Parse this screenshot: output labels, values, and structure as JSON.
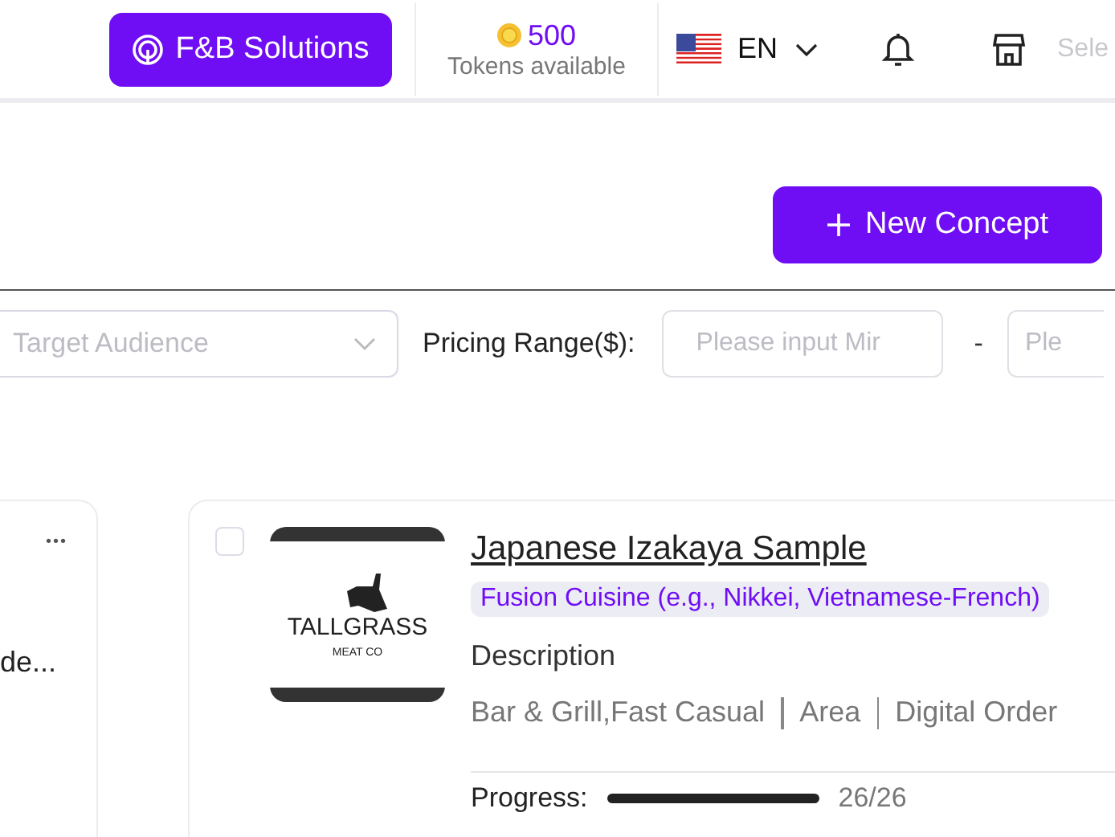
{
  "header": {
    "brand_button": "F&B Solutions",
    "tokens": {
      "amount": "500",
      "label": "Tokens available"
    },
    "language": "EN",
    "store_label": "Sele"
  },
  "new_concept_button": "New Concept",
  "filters": {
    "audience_placeholder": "Target Audience",
    "pricing_label": "Pricing Range($):",
    "min_placeholder": "Please input Mir",
    "separator": "-",
    "max_placeholder": "Ple"
  },
  "cards": [
    {
      "kind": "partial",
      "more": "•••",
      "text": "de..."
    },
    {
      "kind": "concept",
      "checked": false,
      "logo": {
        "name": "TALLGRASS",
        "sub": "MEAT CO"
      },
      "title": "Japanese Izakaya Sample",
      "tags": [
        "Fusion Cuisine (e.g., Nikkei, Vietnamese-French)"
      ],
      "description_label": "Description",
      "meta": [
        "Bar & Grill,Fast Casual",
        "Area",
        "Digital Order"
      ],
      "progress": {
        "label": "Progress:",
        "level": 1,
        "reading": "26/26"
      }
    }
  ]
}
